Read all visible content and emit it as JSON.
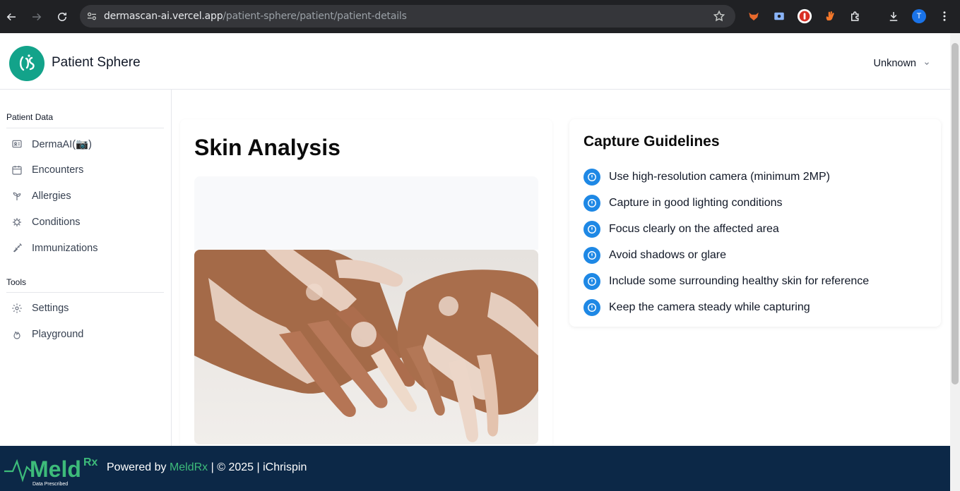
{
  "browser": {
    "url_host": "dermascan-ai.vercel.app",
    "url_path": "/patient-sphere/patient/patient-details",
    "profile_initial": "T"
  },
  "header": {
    "app_title": "Patient Sphere",
    "user_label": "Unknown"
  },
  "sidebar": {
    "patient_data_label": "Patient Data",
    "patient_items": [
      {
        "label": "DermaAI(📷)",
        "icon": "id-card-icon"
      },
      {
        "label": "Encounters",
        "icon": "calendar-icon"
      },
      {
        "label": "Allergies",
        "icon": "sprout-icon"
      },
      {
        "label": "Conditions",
        "icon": "virus-icon"
      },
      {
        "label": "Immunizations",
        "icon": "syringe-icon"
      }
    ],
    "tools_label": "Tools",
    "tool_items": [
      {
        "label": "Settings",
        "icon": "gear-icon"
      },
      {
        "label": "Playground",
        "icon": "flame-icon"
      }
    ]
  },
  "skin_analysis": {
    "title": "Skin Analysis"
  },
  "guidelines": {
    "title": "Capture Guidelines",
    "items": [
      "Use high-resolution camera (minimum 2MP)",
      "Capture in good lighting conditions",
      "Focus clearly on the affected area",
      "Avoid shadows or glare",
      "Include some surrounding healthy skin for reference",
      "Keep the camera steady while capturing"
    ]
  },
  "footer": {
    "powered_prefix": "Powered by ",
    "brand_link": "MeldRx",
    "suffix": " | © 2025 | iChrispin",
    "logo_text": "Meld",
    "logo_sup": "Rx",
    "logo_tagline": "Data Prescribed"
  },
  "colors": {
    "accent_blue": "#1e88e5",
    "brand_green": "#3dbb7a",
    "footer_bg": "#0c2847",
    "logo_teal": "#13a38a"
  }
}
